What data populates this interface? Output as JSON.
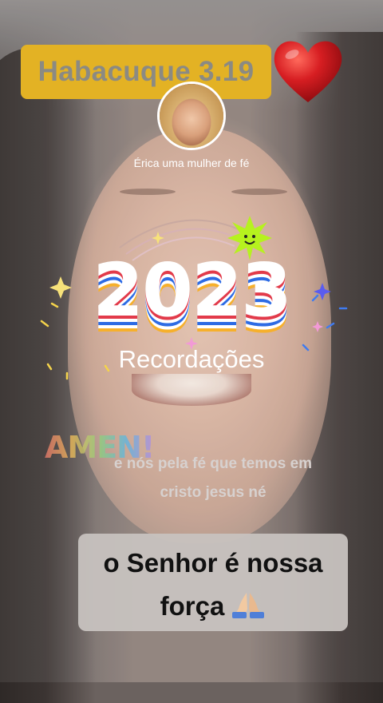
{
  "verse_sticker": {
    "text": "Habacuque 3.19"
  },
  "profile": {
    "name": "Érica uma mulher de fé"
  },
  "recap": {
    "year": "2023",
    "label": "Recordações"
  },
  "amen_sticker": {
    "text": "AMEN!"
  },
  "caption": {
    "line1": "e nós pela fé que temos em",
    "line2": "cristo jesus né"
  },
  "strength_box": {
    "line1": "o Senhor é nossa",
    "line2": "força"
  },
  "icons": {
    "heart": "heart-icon",
    "pray": "praying-hands-icon",
    "sun": "smiling-sun-icon"
  },
  "colors": {
    "verse_bg": "#e3b224",
    "heart": "#c8191c",
    "year_stripe_red": "#e23a4a",
    "year_stripe_blue": "#2d6be4",
    "year_stripe_yellow": "#f6b02c",
    "sun": "#b6f21e"
  }
}
